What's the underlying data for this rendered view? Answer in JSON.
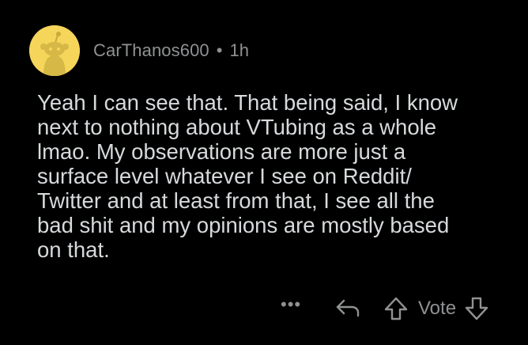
{
  "comment": {
    "username": "CarThanos600",
    "separator": "•",
    "time": "1h",
    "text": "Yeah I can see that. That being said, I know\nnext to nothing about VTubing as a whole\nlmao. My observations are more just a\nsurface level whatever I see on Reddit/\nTwitter and at least from that, I see all the\nbad shit and my opinions are mostly based\non that.",
    "actions": {
      "more": "•••",
      "vote_label": "Vote"
    }
  },
  "icons": {
    "avatar": "snoo-avatar-icon",
    "reply": "reply-arrow-icon",
    "upvote": "upvote-arrow-icon",
    "downvote": "downvote-arrow-icon"
  },
  "colors": {
    "background": "#000000",
    "text": "#d7dadc",
    "muted": "#8f9193",
    "avatar_bg": "#f5d55a"
  }
}
